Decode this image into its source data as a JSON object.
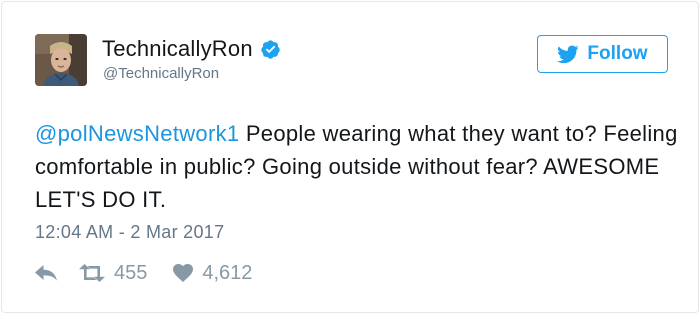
{
  "author": {
    "display_name": "TechnicallyRon",
    "handle": "@TechnicallyRon",
    "verified": true
  },
  "follow_button": {
    "label": "Follow"
  },
  "tweet": {
    "mention": "@polNewsNetwork1",
    "body": " People wearing what they want to? Feeling comfortable in public? Going outside without fear? AWESOME LET'S DO IT.",
    "timestamp": "12:04 AM - 2 Mar 2017"
  },
  "stats": {
    "retweets": "455",
    "likes": "4,612"
  },
  "icons": {
    "avatar": "user-avatar",
    "verified": "verified-badge-icon",
    "follow": "twitter-bird-icon",
    "reply": "reply-icon",
    "retweet": "retweet-icon",
    "like": "heart-icon"
  },
  "colors": {
    "brand_blue": "#1da1f2",
    "mention_blue": "#1b95e0",
    "muted_gray": "#657786",
    "action_gray": "#8899a6",
    "text": "#14171a",
    "border": "#e1e8ed"
  }
}
